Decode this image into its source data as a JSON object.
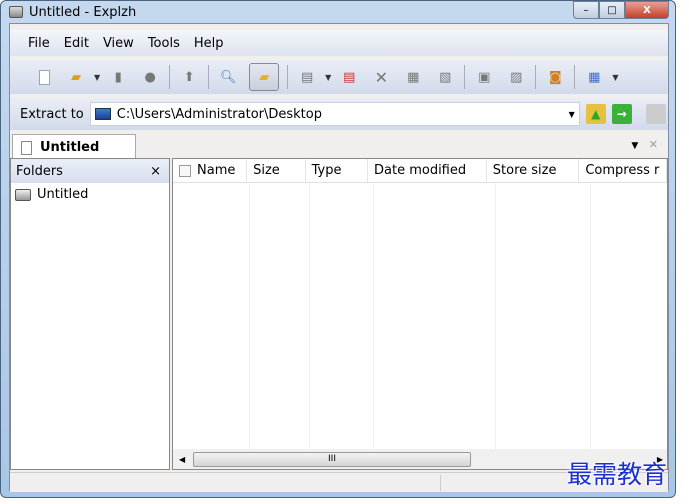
{
  "window": {
    "title": "Untitled - Explzh",
    "minimize": "–",
    "maximize": "□",
    "close": "X"
  },
  "menu": [
    "File",
    "Edit",
    "View",
    "Tools",
    "Help"
  ],
  "toolbar": {
    "icons": [
      "new-icon",
      "open-icon",
      "save-icon",
      "test-icon",
      "up-icon",
      "find-icon",
      "folder-tree-icon",
      "add-files-icon",
      "extract-icon",
      "delete-icon",
      "copy-icon",
      "properties-icon",
      "rename-icon",
      "convert-icon",
      "viewer-icon",
      "view-mode-icon"
    ]
  },
  "extract": {
    "label": "Extract to",
    "path": "C:\\Users\\Administrator\\Desktop"
  },
  "tab": {
    "label": "Untitled"
  },
  "folders": {
    "header": "Folders",
    "close": "×",
    "items": [
      "Untitled"
    ]
  },
  "list": {
    "columns": [
      "Name",
      "Size",
      "Type",
      "Date modified",
      "Store size",
      "Compress r"
    ]
  },
  "scroll": {
    "grip": "III"
  },
  "watermark": "最需教育"
}
